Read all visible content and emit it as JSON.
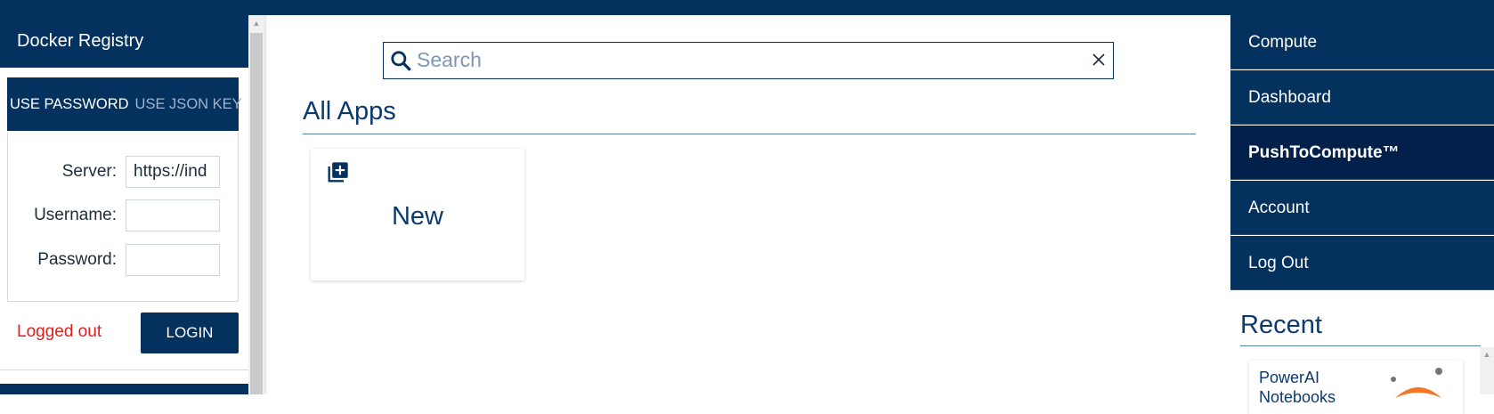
{
  "docker_registry": {
    "title": "Docker Registry",
    "tabs": [
      {
        "label": "USE PASSWORD"
      },
      {
        "label": "USE JSON KEY"
      }
    ],
    "fields": {
      "server_label": "Server:",
      "server_value": "https://ind",
      "username_label": "Username:",
      "username_value": "",
      "password_label": "Password:",
      "password_value": ""
    },
    "status": "Logged out",
    "login_label": "LOGIN"
  },
  "main": {
    "search": {
      "placeholder": "Search",
      "value": ""
    },
    "section_title": "All Apps",
    "apps": [
      {
        "label": "New",
        "icon": "add-library-icon"
      }
    ]
  },
  "nav": {
    "items": [
      {
        "label": "Compute"
      },
      {
        "label": "Dashboard"
      },
      {
        "label": "PushToCompute™"
      },
      {
        "label": "Account"
      },
      {
        "label": "Log Out"
      }
    ],
    "active_item": "PushToCompute™"
  },
  "recent": {
    "title": "Recent",
    "items": [
      {
        "title": "PowerAI",
        "subtitle": "Notebooks",
        "icon": "jupyter-logo-icon"
      }
    ]
  },
  "colors": {
    "brand_navy": "#05315f",
    "active_nav": "#02204a",
    "status_error": "#e02020",
    "accent_orange": "#f37726"
  }
}
